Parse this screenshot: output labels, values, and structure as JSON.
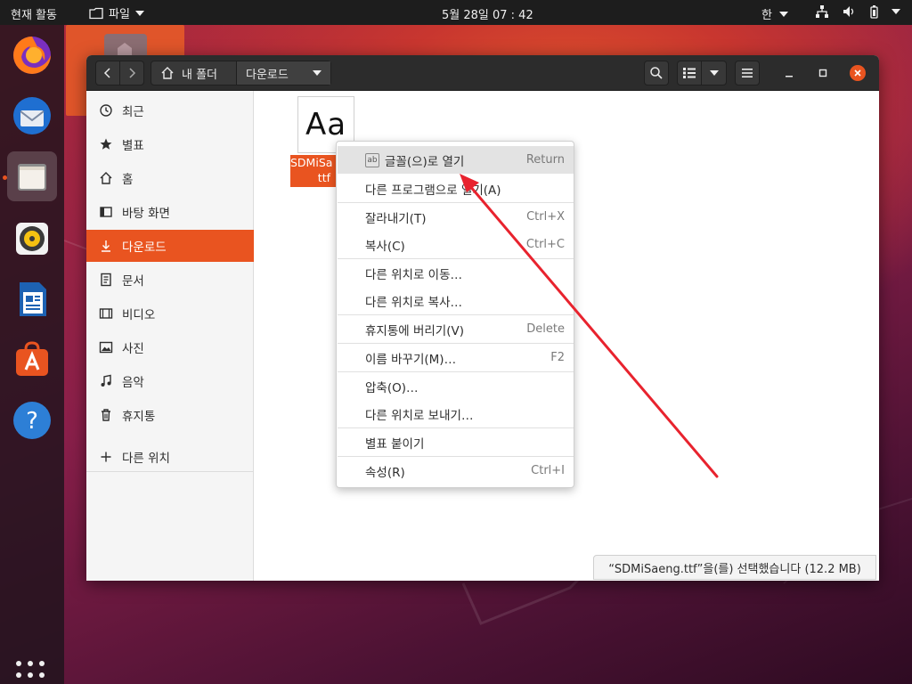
{
  "topbar": {
    "activities": "현재 활동",
    "app_menu": "파일",
    "clock": "5월 28일  07 : 42",
    "input_method": "한"
  },
  "dock": {
    "items": [
      {
        "name": "firefox-icon"
      },
      {
        "name": "thunderbird-icon"
      },
      {
        "name": "files-icon",
        "active": true
      },
      {
        "name": "rhythmbox-icon"
      },
      {
        "name": "libreoffice-writer-icon"
      },
      {
        "name": "software-center-icon"
      },
      {
        "name": "help-icon",
        "glyph": "?"
      }
    ]
  },
  "window": {
    "path": {
      "home": "내 폴더",
      "current": "다운로드"
    }
  },
  "sidebar": {
    "items": [
      {
        "label": "최근",
        "icon": "clock-icon"
      },
      {
        "label": "별표",
        "icon": "star-icon"
      },
      {
        "label": "홈",
        "icon": "home-icon"
      },
      {
        "label": "바탕 화면",
        "icon": "desktop-icon"
      },
      {
        "label": "다운로드",
        "icon": "download-icon",
        "active": true
      },
      {
        "label": "문서",
        "icon": "document-icon"
      },
      {
        "label": "비디오",
        "icon": "video-icon"
      },
      {
        "label": "사진",
        "icon": "picture-icon"
      },
      {
        "label": "음악",
        "icon": "music-icon"
      },
      {
        "label": "휴지통",
        "icon": "trash-icon"
      }
    ],
    "other_locations": "다른 위치"
  },
  "file": {
    "thumb_text": "Aa",
    "name_line1": "SDMiSa",
    "name_line2": "ttf"
  },
  "context_menu": {
    "items": [
      {
        "label": "글꼴(으)로 열기",
        "accel": "Return"
      },
      {
        "label": "다른 프로그램으로 열기(A)",
        "accel": ""
      },
      {
        "label": "잘라내기(T)",
        "accel": "Ctrl+X"
      },
      {
        "label": "복사(C)",
        "accel": "Ctrl+C"
      },
      {
        "label": "다른 위치로 이동…",
        "accel": ""
      },
      {
        "label": "다른 위치로 복사…",
        "accel": ""
      },
      {
        "label": "휴지통에 버리기(V)",
        "accel": "Delete"
      },
      {
        "label": "이름 바꾸기(M)…",
        "accel": "F2"
      },
      {
        "label": "압축(O)…",
        "accel": ""
      },
      {
        "label": "다른 위치로 보내기…",
        "accel": ""
      },
      {
        "label": "별표 붙이기",
        "accel": ""
      },
      {
        "label": "속성(R)",
        "accel": "Ctrl+I"
      }
    ]
  },
  "statusbar": {
    "text": "“SDMiSaeng.ttf”을(를) 선택했습니다  (12.2 MB)"
  },
  "colors": {
    "accent": "#e95420",
    "annotation_arrow": "#e8232e"
  }
}
